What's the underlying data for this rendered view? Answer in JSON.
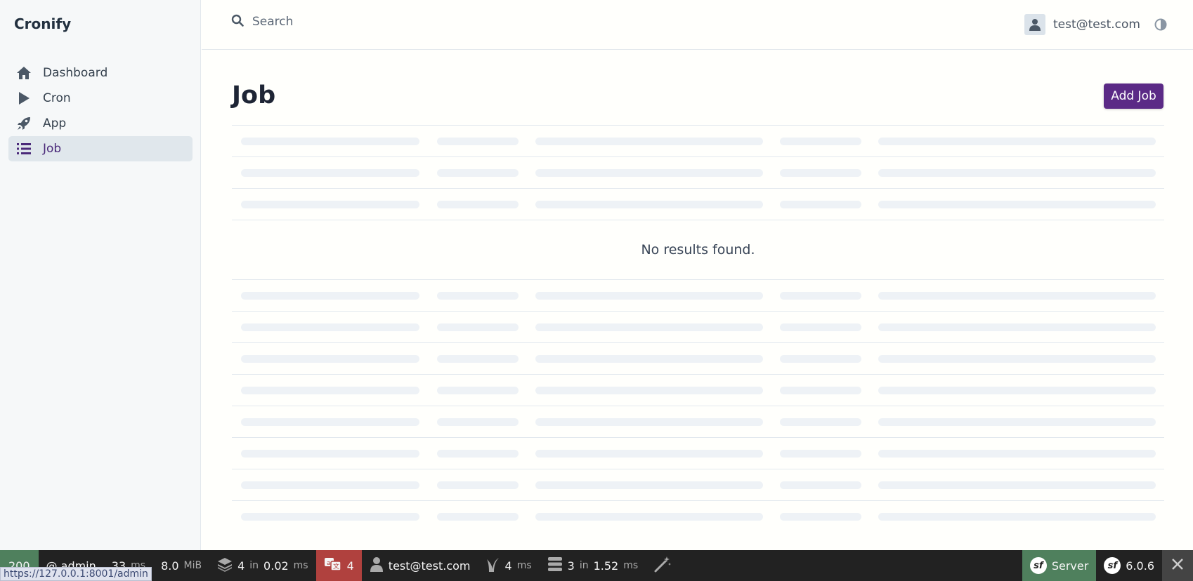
{
  "brand": "Cronify",
  "sidebar": {
    "items": [
      {
        "label": "Dashboard",
        "icon": "home-icon"
      },
      {
        "label": "Cron",
        "icon": "play-icon"
      },
      {
        "label": "App",
        "icon": "rocket-icon"
      },
      {
        "label": "Job",
        "icon": "list-icon",
        "active": true
      }
    ]
  },
  "header": {
    "search_placeholder": "Search",
    "user_email": "test@test.com"
  },
  "main": {
    "title": "Job",
    "add_button": "Add Job",
    "empty_message": "No results found."
  },
  "toolbar": {
    "status_code": "200",
    "route": "@ admin",
    "time_value": "33",
    "time_unit": "ms",
    "memory_value": "8.0",
    "memory_unit": "MiB",
    "cache_count": "4",
    "cache_in": "in",
    "cache_time": "0.02",
    "cache_unit": "ms",
    "translation_count": "4",
    "user": "test@test.com",
    "twig_time": "4",
    "twig_unit": "ms",
    "db_count": "3",
    "db_in": "in",
    "db_time": "1.52",
    "db_unit": "ms",
    "server_label": "Server",
    "symfony_version": "6.0.6",
    "hover_url": "https://127.0.0.1:8001/admin"
  },
  "colors": {
    "accent": "#5b2a86",
    "sidebar_active_bg": "#e0e7ec",
    "toolbar_bg": "#222222",
    "toolbar_success": "#4f805d",
    "toolbar_warning": "#b0413e"
  }
}
